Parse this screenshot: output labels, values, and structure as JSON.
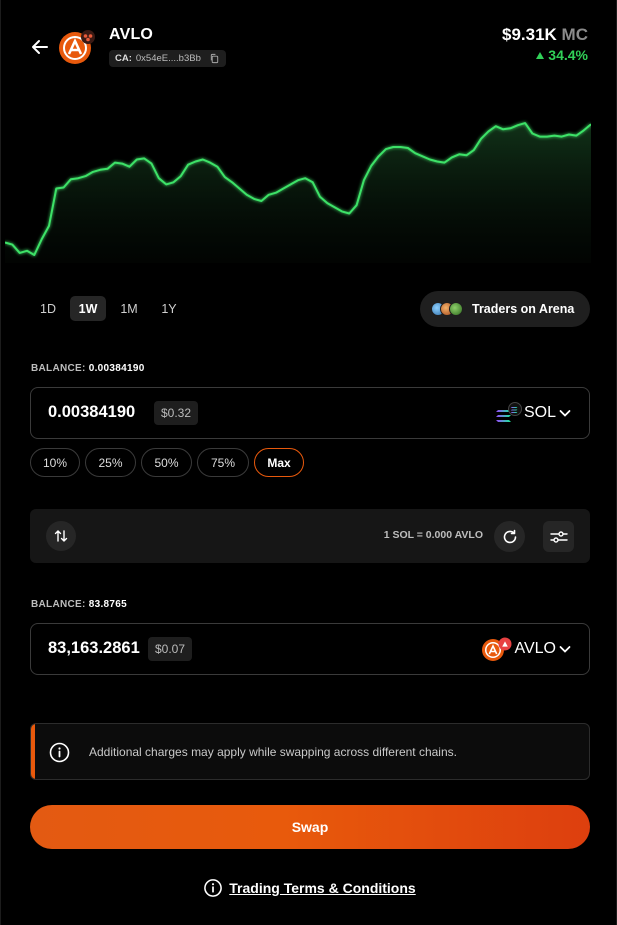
{
  "header": {
    "token_symbol": "AVLO",
    "ca_label": "CA:",
    "ca_value": "0x54eE....b3Bb",
    "market_cap_value": "$9.31K",
    "market_cap_unit": "MC",
    "change": "34.4%"
  },
  "colors": {
    "accent": "#e8590c",
    "positive": "#31d158",
    "chart_line": "#3ee267"
  },
  "chart_data": {
    "type": "area",
    "series": [
      {
        "values": [
          228,
          230,
          238,
          236,
          240,
          225,
          212,
          176,
          175,
          167,
          166,
          164,
          160,
          158,
          157,
          151,
          152,
          155,
          148,
          147,
          152,
          166,
          172,
          170,
          164,
          153,
          150,
          148,
          151,
          155,
          165,
          170,
          176,
          182,
          186,
          188,
          182,
          180,
          176,
          172,
          168,
          166,
          170,
          184,
          190,
          194,
          198,
          200,
          192,
          168,
          154,
          145,
          138,
          136,
          136,
          137,
          142,
          145,
          148,
          150,
          151,
          146,
          143,
          144,
          139,
          128,
          121,
          116,
          119,
          118,
          115,
          113,
          123,
          126,
          126,
          125,
          126,
          124,
          125,
          120,
          114
        ]
      }
    ],
    "ylim": [
      110,
      240
    ],
    "grid": false
  },
  "timeframes": [
    {
      "label": "1D",
      "active": false
    },
    {
      "label": "1W",
      "active": true
    },
    {
      "label": "1M",
      "active": false
    },
    {
      "label": "1Y",
      "active": false
    }
  ],
  "traders_button": "Traders on Arena",
  "from": {
    "balance_label": "BALANCE:",
    "balance_value": "0.00384190",
    "amount": "0.00384190",
    "usd": "$0.32",
    "token": "SOL"
  },
  "percent_buttons": [
    "10%",
    "25%",
    "50%",
    "75%",
    "Max"
  ],
  "rate": "1 SOL = 0.000 AVLO",
  "to": {
    "balance_label": "BALANCE:",
    "balance_value": "83.8765",
    "amount": "83,163.2861",
    "usd": "$0.07",
    "token": "AVLO"
  },
  "notice": "Additional charges may apply while swapping across different chains.",
  "swap_button": "Swap",
  "terms_link": "Trading Terms & Conditions"
}
